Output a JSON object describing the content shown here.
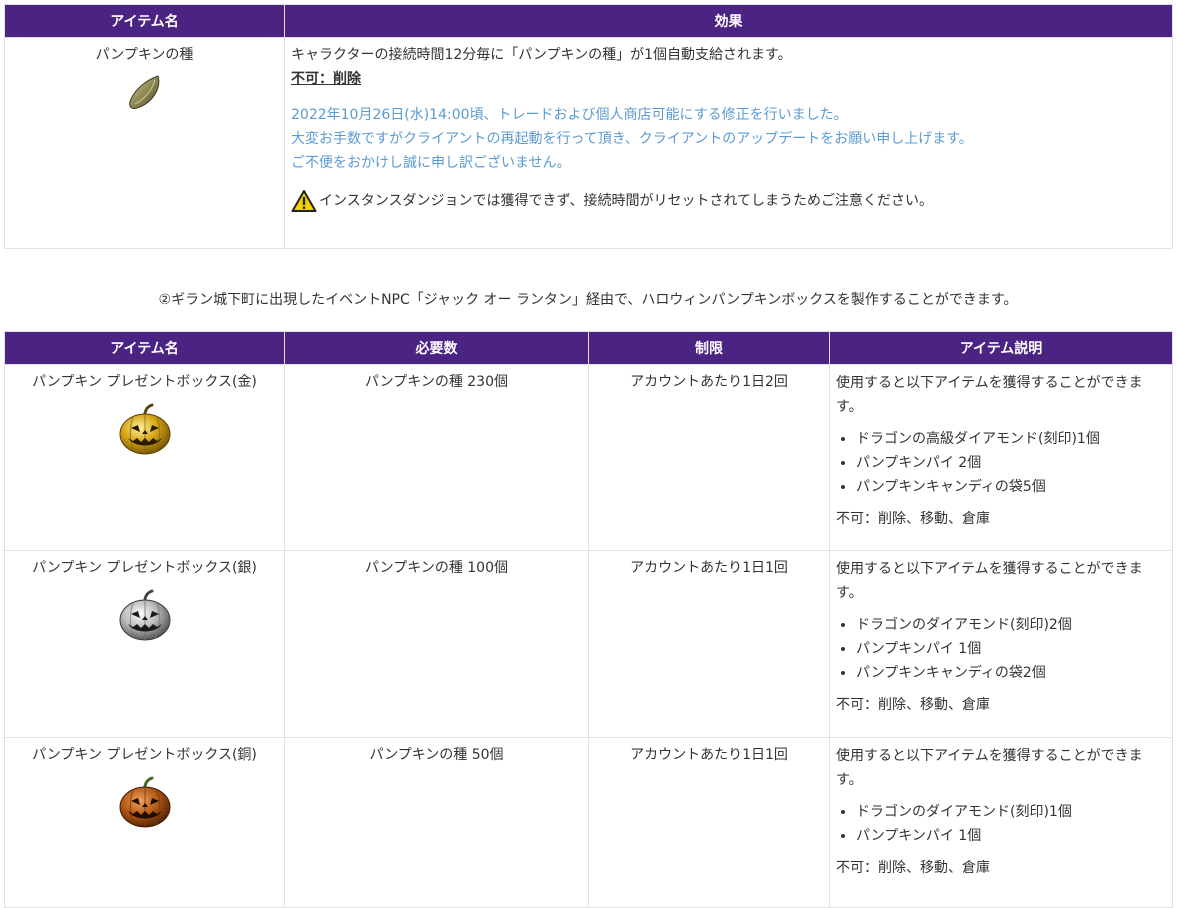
{
  "table1": {
    "headers": [
      "アイテム名",
      "効果"
    ],
    "row": {
      "name": "パンプキンの種",
      "icon": "pumpkin-seed-icon",
      "effect_line": "キャラクターの接続時間12分毎に「パンプキンの種」が1個自動支給されます。",
      "restriction": "不可：削除",
      "notice_lines": [
        "2022年10月26日(水)14:00頃、トレードおよび個人商店可能にする修正を行いました。",
        "大変お手数ですがクライアントの再起動を行って頂き、クライアントのアップデートをお願い申し上げます。",
        "ご不便をおかけし誠に申し訳ございません。"
      ],
      "warning_icon": "warning-icon",
      "warning_text": "インスタンスダンジョンでは獲得できず、接続時間がリセットされてしまうためご注意ください。"
    }
  },
  "caption": "②ギラン城下町に出現したイベントNPC「ジャック オー ランタン」経由で、ハロウィンパンプキンボックスを製作することができます。",
  "table2": {
    "headers": [
      "アイテム名",
      "必要数",
      "制限",
      "アイテム説明"
    ],
    "rows": [
      {
        "name": "パンプキン プレゼントボックス(金)",
        "icon": "gold-pumpkin-box-icon",
        "required": "パンプキンの種 230個",
        "limit": "アカウントあたり1日2回",
        "desc_intro": "使用すると以下アイテムを獲得することができます。",
        "items": [
          "ドラゴンの高級ダイアモンド(刻印)1個",
          "パンプキンパイ 2個",
          "パンプキンキャンディの袋5個"
        ],
        "restriction": "不可：削除、移動、倉庫"
      },
      {
        "name": "パンプキン プレゼントボックス(銀)",
        "icon": "silver-pumpkin-box-icon",
        "required": "パンプキンの種 100個",
        "limit": "アカウントあたり1日1回",
        "desc_intro": "使用すると以下アイテムを獲得することができます。",
        "items": [
          "ドラゴンのダイアモンド(刻印)2個",
          "パンプキンパイ 1個",
          "パンプキンキャンディの袋2個"
        ],
        "restriction": "不可：削除、移動、倉庫"
      },
      {
        "name": "パンプキン プレゼントボックス(銅)",
        "icon": "bronze-pumpkin-box-icon",
        "required": "パンプキンの種 50個",
        "limit": "アカウントあたり1日1回",
        "desc_intro": "使用すると以下アイテムを獲得することができます。",
        "items": [
          "ドラゴンのダイアモンド(刻印)1個",
          "パンプキンパイ 1個"
        ],
        "restriction": "不可：削除、移動、倉庫"
      }
    ]
  },
  "colors": {
    "header_bg": "#4b2382",
    "notice_text": "#5b9bd1",
    "gold": "#d4a413",
    "silver": "#b8b8b8",
    "bronze": "#b45a16"
  }
}
